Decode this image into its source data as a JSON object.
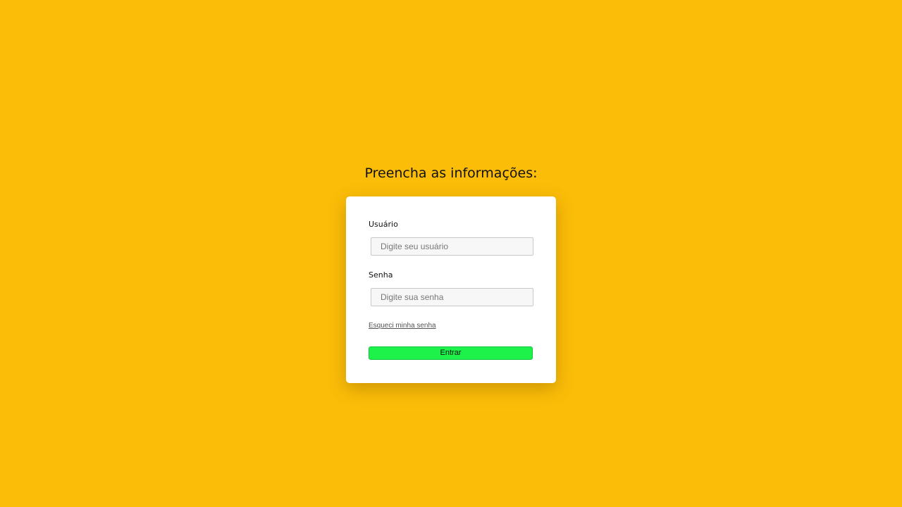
{
  "page": {
    "heading": "Preencha as informações:",
    "background_color": "#fbbd08"
  },
  "form": {
    "username": {
      "label": "Usuário",
      "placeholder": "Digite seu usuário",
      "value": ""
    },
    "password": {
      "label": "Senha",
      "placeholder": "Digite sua senha",
      "value": ""
    },
    "forgot_link": "Esqueci minha senha",
    "submit_label": "Entrar",
    "submit_color": "#1df24a"
  }
}
